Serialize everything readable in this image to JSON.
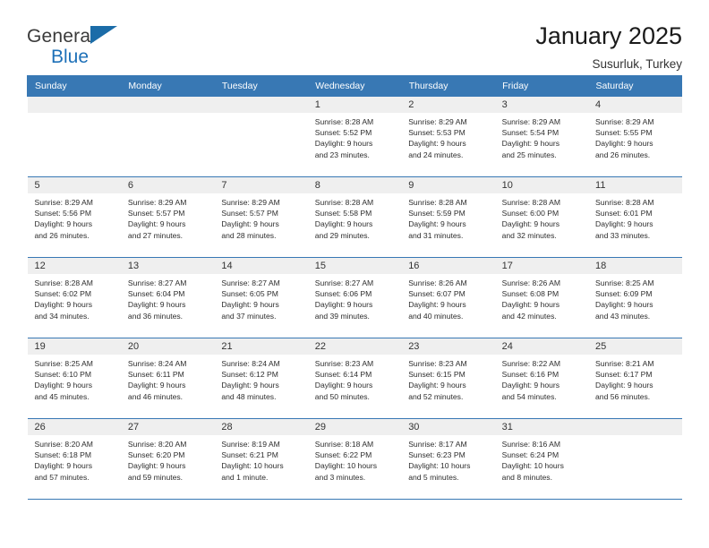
{
  "brand": {
    "name_part1": "General",
    "name_part2": "Blue",
    "flag_icon": "flag-triangle-icon"
  },
  "header": {
    "title": "January 2025",
    "subtitle": "Susurluk, Turkey"
  },
  "weekday_headers": [
    "Sunday",
    "Monday",
    "Tuesday",
    "Wednesday",
    "Thursday",
    "Friday",
    "Saturday"
  ],
  "colors": {
    "header_blue": "#3878b4",
    "brand_blue": "#1d70b8",
    "daynum_band": "#efefef",
    "text": "#2d2d2d"
  },
  "weeks": [
    [
      {
        "day": "",
        "sunrise": "",
        "sunset": "",
        "daylight_line1": "",
        "daylight_line2": "",
        "empty": true
      },
      {
        "day": "",
        "sunrise": "",
        "sunset": "",
        "daylight_line1": "",
        "daylight_line2": "",
        "empty": true
      },
      {
        "day": "",
        "sunrise": "",
        "sunset": "",
        "daylight_line1": "",
        "daylight_line2": "",
        "empty": true
      },
      {
        "day": "1",
        "sunrise": "Sunrise: 8:28 AM",
        "sunset": "Sunset: 5:52 PM",
        "daylight_line1": "Daylight: 9 hours",
        "daylight_line2": "and 23 minutes."
      },
      {
        "day": "2",
        "sunrise": "Sunrise: 8:29 AM",
        "sunset": "Sunset: 5:53 PM",
        "daylight_line1": "Daylight: 9 hours",
        "daylight_line2": "and 24 minutes."
      },
      {
        "day": "3",
        "sunrise": "Sunrise: 8:29 AM",
        "sunset": "Sunset: 5:54 PM",
        "daylight_line1": "Daylight: 9 hours",
        "daylight_line2": "and 25 minutes."
      },
      {
        "day": "4",
        "sunrise": "Sunrise: 8:29 AM",
        "sunset": "Sunset: 5:55 PM",
        "daylight_line1": "Daylight: 9 hours",
        "daylight_line2": "and 26 minutes."
      }
    ],
    [
      {
        "day": "5",
        "sunrise": "Sunrise: 8:29 AM",
        "sunset": "Sunset: 5:56 PM",
        "daylight_line1": "Daylight: 9 hours",
        "daylight_line2": "and 26 minutes."
      },
      {
        "day": "6",
        "sunrise": "Sunrise: 8:29 AM",
        "sunset": "Sunset: 5:57 PM",
        "daylight_line1": "Daylight: 9 hours",
        "daylight_line2": "and 27 minutes."
      },
      {
        "day": "7",
        "sunrise": "Sunrise: 8:29 AM",
        "sunset": "Sunset: 5:57 PM",
        "daylight_line1": "Daylight: 9 hours",
        "daylight_line2": "and 28 minutes."
      },
      {
        "day": "8",
        "sunrise": "Sunrise: 8:28 AM",
        "sunset": "Sunset: 5:58 PM",
        "daylight_line1": "Daylight: 9 hours",
        "daylight_line2": "and 29 minutes."
      },
      {
        "day": "9",
        "sunrise": "Sunrise: 8:28 AM",
        "sunset": "Sunset: 5:59 PM",
        "daylight_line1": "Daylight: 9 hours",
        "daylight_line2": "and 31 minutes."
      },
      {
        "day": "10",
        "sunrise": "Sunrise: 8:28 AM",
        "sunset": "Sunset: 6:00 PM",
        "daylight_line1": "Daylight: 9 hours",
        "daylight_line2": "and 32 minutes."
      },
      {
        "day": "11",
        "sunrise": "Sunrise: 8:28 AM",
        "sunset": "Sunset: 6:01 PM",
        "daylight_line1": "Daylight: 9 hours",
        "daylight_line2": "and 33 minutes."
      }
    ],
    [
      {
        "day": "12",
        "sunrise": "Sunrise: 8:28 AM",
        "sunset": "Sunset: 6:02 PM",
        "daylight_line1": "Daylight: 9 hours",
        "daylight_line2": "and 34 minutes."
      },
      {
        "day": "13",
        "sunrise": "Sunrise: 8:27 AM",
        "sunset": "Sunset: 6:04 PM",
        "daylight_line1": "Daylight: 9 hours",
        "daylight_line2": "and 36 minutes."
      },
      {
        "day": "14",
        "sunrise": "Sunrise: 8:27 AM",
        "sunset": "Sunset: 6:05 PM",
        "daylight_line1": "Daylight: 9 hours",
        "daylight_line2": "and 37 minutes."
      },
      {
        "day": "15",
        "sunrise": "Sunrise: 8:27 AM",
        "sunset": "Sunset: 6:06 PM",
        "daylight_line1": "Daylight: 9 hours",
        "daylight_line2": "and 39 minutes."
      },
      {
        "day": "16",
        "sunrise": "Sunrise: 8:26 AM",
        "sunset": "Sunset: 6:07 PM",
        "daylight_line1": "Daylight: 9 hours",
        "daylight_line2": "and 40 minutes."
      },
      {
        "day": "17",
        "sunrise": "Sunrise: 8:26 AM",
        "sunset": "Sunset: 6:08 PM",
        "daylight_line1": "Daylight: 9 hours",
        "daylight_line2": "and 42 minutes."
      },
      {
        "day": "18",
        "sunrise": "Sunrise: 8:25 AM",
        "sunset": "Sunset: 6:09 PM",
        "daylight_line1": "Daylight: 9 hours",
        "daylight_line2": "and 43 minutes."
      }
    ],
    [
      {
        "day": "19",
        "sunrise": "Sunrise: 8:25 AM",
        "sunset": "Sunset: 6:10 PM",
        "daylight_line1": "Daylight: 9 hours",
        "daylight_line2": "and 45 minutes."
      },
      {
        "day": "20",
        "sunrise": "Sunrise: 8:24 AM",
        "sunset": "Sunset: 6:11 PM",
        "daylight_line1": "Daylight: 9 hours",
        "daylight_line2": "and 46 minutes."
      },
      {
        "day": "21",
        "sunrise": "Sunrise: 8:24 AM",
        "sunset": "Sunset: 6:12 PM",
        "daylight_line1": "Daylight: 9 hours",
        "daylight_line2": "and 48 minutes."
      },
      {
        "day": "22",
        "sunrise": "Sunrise: 8:23 AM",
        "sunset": "Sunset: 6:14 PM",
        "daylight_line1": "Daylight: 9 hours",
        "daylight_line2": "and 50 minutes."
      },
      {
        "day": "23",
        "sunrise": "Sunrise: 8:23 AM",
        "sunset": "Sunset: 6:15 PM",
        "daylight_line1": "Daylight: 9 hours",
        "daylight_line2": "and 52 minutes."
      },
      {
        "day": "24",
        "sunrise": "Sunrise: 8:22 AM",
        "sunset": "Sunset: 6:16 PM",
        "daylight_line1": "Daylight: 9 hours",
        "daylight_line2": "and 54 minutes."
      },
      {
        "day": "25",
        "sunrise": "Sunrise: 8:21 AM",
        "sunset": "Sunset: 6:17 PM",
        "daylight_line1": "Daylight: 9 hours",
        "daylight_line2": "and 56 minutes."
      }
    ],
    [
      {
        "day": "26",
        "sunrise": "Sunrise: 8:20 AM",
        "sunset": "Sunset: 6:18 PM",
        "daylight_line1": "Daylight: 9 hours",
        "daylight_line2": "and 57 minutes."
      },
      {
        "day": "27",
        "sunrise": "Sunrise: 8:20 AM",
        "sunset": "Sunset: 6:20 PM",
        "daylight_line1": "Daylight: 9 hours",
        "daylight_line2": "and 59 minutes."
      },
      {
        "day": "28",
        "sunrise": "Sunrise: 8:19 AM",
        "sunset": "Sunset: 6:21 PM",
        "daylight_line1": "Daylight: 10 hours",
        "daylight_line2": "and 1 minute."
      },
      {
        "day": "29",
        "sunrise": "Sunrise: 8:18 AM",
        "sunset": "Sunset: 6:22 PM",
        "daylight_line1": "Daylight: 10 hours",
        "daylight_line2": "and 3 minutes."
      },
      {
        "day": "30",
        "sunrise": "Sunrise: 8:17 AM",
        "sunset": "Sunset: 6:23 PM",
        "daylight_line1": "Daylight: 10 hours",
        "daylight_line2": "and 5 minutes."
      },
      {
        "day": "31",
        "sunrise": "Sunrise: 8:16 AM",
        "sunset": "Sunset: 6:24 PM",
        "daylight_line1": "Daylight: 10 hours",
        "daylight_line2": "and 8 minutes."
      },
      {
        "day": "",
        "sunrise": "",
        "sunset": "",
        "daylight_line1": "",
        "daylight_line2": "",
        "empty": true
      }
    ]
  ]
}
